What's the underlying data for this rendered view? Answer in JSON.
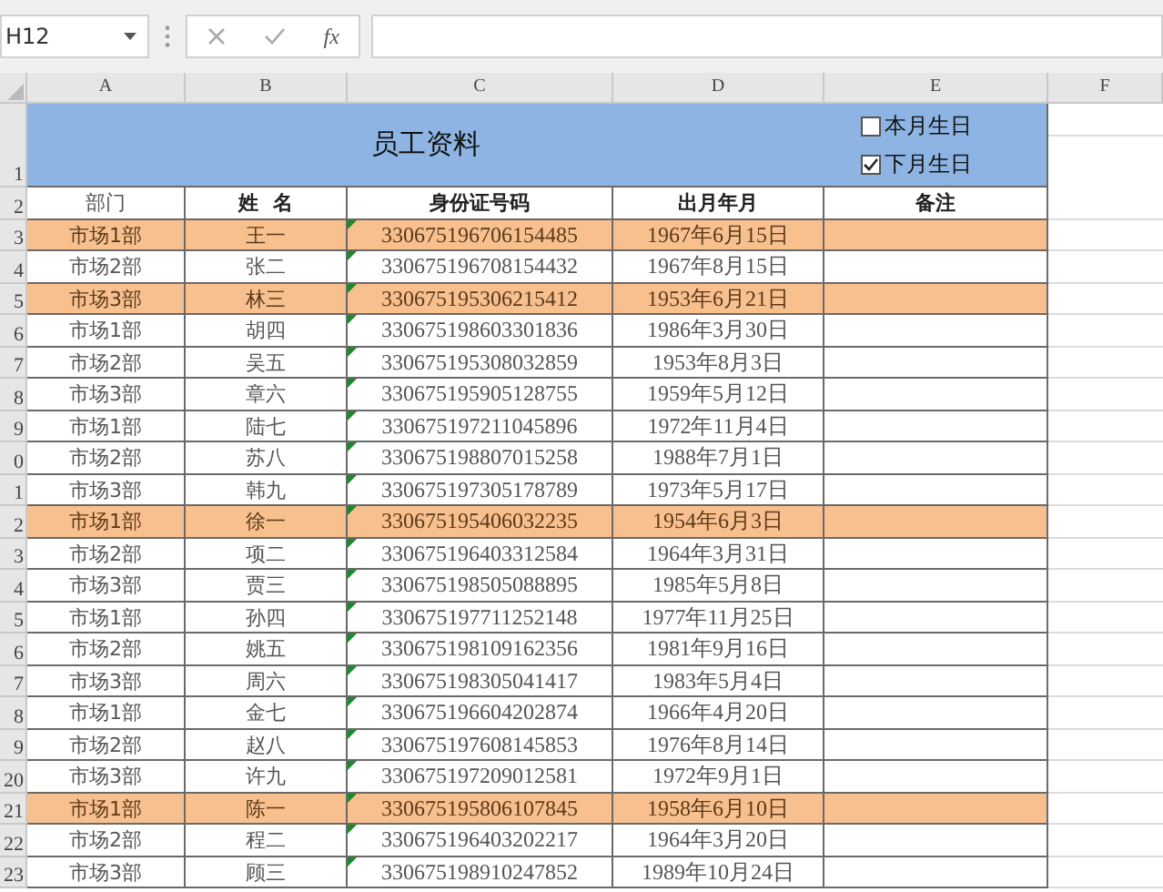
{
  "formula_bar": {
    "name_box": "H12",
    "fx": "fx"
  },
  "columns": [
    "A",
    "B",
    "C",
    "D",
    "E",
    "F"
  ],
  "title_row": {
    "num": "1",
    "title": "员工资料",
    "checkboxes": [
      {
        "label": "本月生日",
        "checked": false
      },
      {
        "label": "下月生日",
        "checked": true
      }
    ]
  },
  "header_row": {
    "num": "2",
    "cells": [
      {
        "text": "部门",
        "bold": false
      },
      {
        "text": "姓  名",
        "bold": true
      },
      {
        "text": "身份证号码",
        "bold": true
      },
      {
        "text": "出月年月",
        "bold": true
      },
      {
        "text": "备注",
        "bold": true
      }
    ]
  },
  "rows": [
    {
      "num": "3",
      "dept": "市场1部",
      "name": "王一",
      "id": "330675196706154485",
      "birth": "1967年6月15日",
      "highlight": true
    },
    {
      "num": "4",
      "dept": "市场2部",
      "name": "张二",
      "id": "330675196708154432",
      "birth": "1967年8月15日",
      "highlight": false
    },
    {
      "num": "5",
      "dept": "市场3部",
      "name": "林三",
      "id": "330675195306215412",
      "birth": "1953年6月21日",
      "highlight": true
    },
    {
      "num": "6",
      "dept": "市场1部",
      "name": "胡四",
      "id": "330675198603301836",
      "birth": "1986年3月30日",
      "highlight": false
    },
    {
      "num": "7",
      "dept": "市场2部",
      "name": "吴五",
      "id": "330675195308032859",
      "birth": "1953年8月3日",
      "highlight": false
    },
    {
      "num": "8",
      "dept": "市场3部",
      "name": "章六",
      "id": "330675195905128755",
      "birth": "1959年5月12日",
      "highlight": false
    },
    {
      "num": "9",
      "dept": "市场1部",
      "name": "陆七",
      "id": "330675197211045896",
      "birth": "1972年11月4日",
      "highlight": false
    },
    {
      "num": "0",
      "dept": "市场2部",
      "name": "苏八",
      "id": "330675198807015258",
      "birth": "1988年7月1日",
      "highlight": false
    },
    {
      "num": "1",
      "dept": "市场3部",
      "name": "韩九",
      "id": "330675197305178789",
      "birth": "1973年5月17日",
      "highlight": false
    },
    {
      "num": "2",
      "dept": "市场1部",
      "name": "徐一",
      "id": "330675195406032235",
      "birth": "1954年6月3日",
      "highlight": true
    },
    {
      "num": "3",
      "dept": "市场2部",
      "name": "项二",
      "id": "330675196403312584",
      "birth": "1964年3月31日",
      "highlight": false
    },
    {
      "num": "4",
      "dept": "市场3部",
      "name": "贾三",
      "id": "330675198505088895",
      "birth": "1985年5月8日",
      "highlight": false
    },
    {
      "num": "5",
      "dept": "市场1部",
      "name": "孙四",
      "id": "330675197711252148",
      "birth": "1977年11月25日",
      "highlight": false
    },
    {
      "num": "6",
      "dept": "市场2部",
      "name": "姚五",
      "id": "330675198109162356",
      "birth": "1981年9月16日",
      "highlight": false
    },
    {
      "num": "7",
      "dept": "市场3部",
      "name": "周六",
      "id": "330675198305041417",
      "birth": "1983年5月4日",
      "highlight": false
    },
    {
      "num": "8",
      "dept": "市场1部",
      "name": "金七",
      "id": "330675196604202874",
      "birth": "1966年4月20日",
      "highlight": false
    },
    {
      "num": "9",
      "dept": "市场2部",
      "name": "赵八",
      "id": "330675197608145853",
      "birth": "1976年8月14日",
      "highlight": false
    },
    {
      "num": "20",
      "dept": "市场3部",
      "name": "许九",
      "id": "330675197209012581",
      "birth": "1972年9月1日",
      "highlight": false
    },
    {
      "num": "21",
      "dept": "市场1部",
      "name": "陈一",
      "id": "330675195806107845",
      "birth": "1958年6月10日",
      "highlight": true
    },
    {
      "num": "22",
      "dept": "市场2部",
      "name": "程二",
      "id": "330675196403202217",
      "birth": "1964年3月20日",
      "highlight": false
    },
    {
      "num": "23",
      "dept": "市场3部",
      "name": "顾三",
      "id": "330675198910247852",
      "birth": "1989年10月24日",
      "highlight": false
    }
  ]
}
